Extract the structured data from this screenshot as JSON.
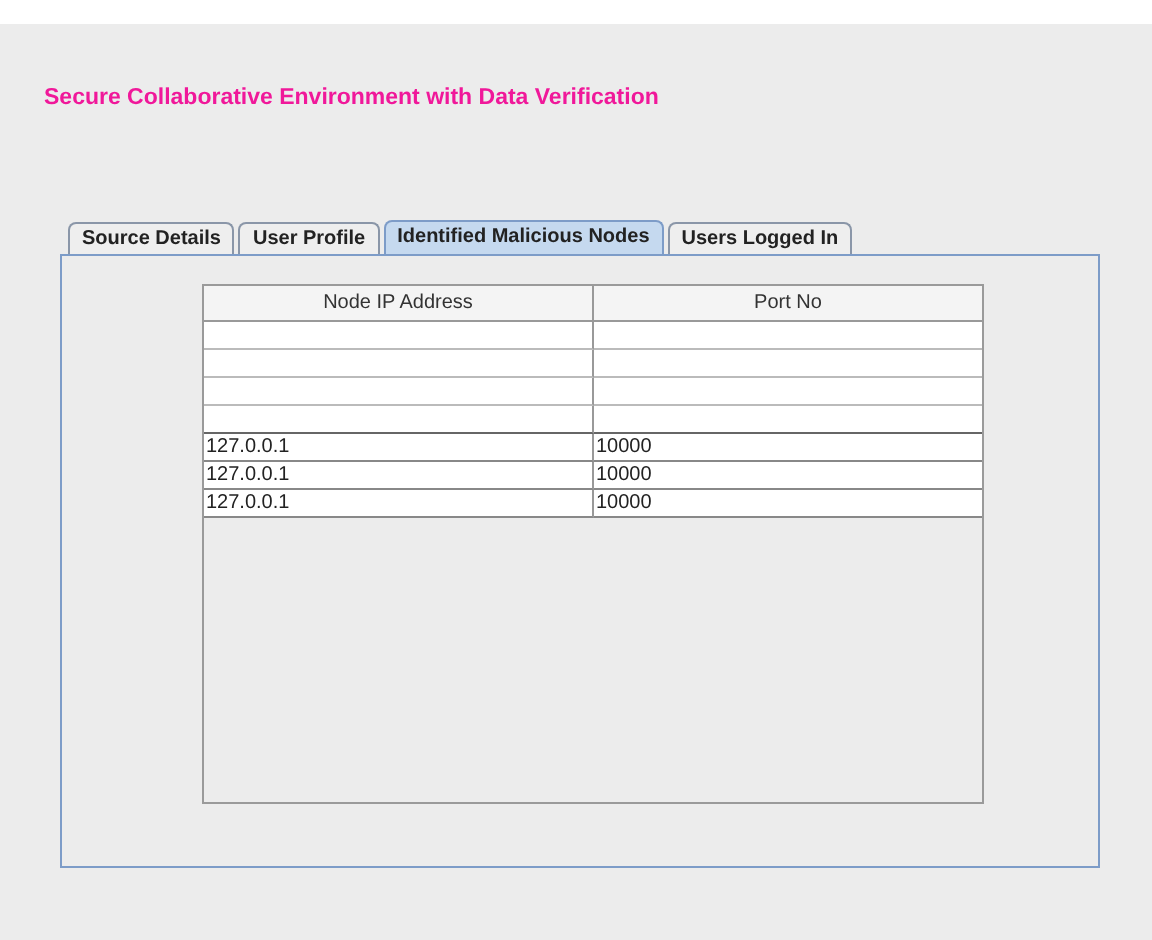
{
  "heading": "Secure Collaborative Environment with Data Verification",
  "tabs": [
    {
      "label": "Source Details",
      "selected": false
    },
    {
      "label": "User Profile",
      "selected": false
    },
    {
      "label": "Identified Malicious Nodes",
      "selected": true
    },
    {
      "label": "Users Logged In",
      "selected": false
    }
  ],
  "table": {
    "columns": [
      "Node IP Address",
      "Port No"
    ],
    "rows": [
      {
        "kind": "blank"
      },
      {
        "kind": "blank"
      },
      {
        "kind": "blank"
      },
      {
        "kind": "blank"
      },
      {
        "kind": "data",
        "cells": [
          "127.0.0.1",
          "10000"
        ]
      },
      {
        "kind": "data",
        "cells": [
          "127.0.0.1",
          "10000"
        ]
      },
      {
        "kind": "data",
        "cells": [
          "127.0.0.1",
          "10000"
        ]
      }
    ]
  }
}
